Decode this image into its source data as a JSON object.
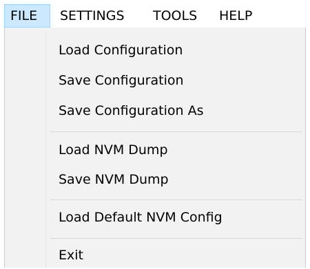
{
  "menubar": {
    "items": [
      {
        "label": "FILE",
        "active": true
      },
      {
        "label": "SETTINGS",
        "active": false
      },
      {
        "label": "TOOLS",
        "active": false
      },
      {
        "label": "HELP",
        "active": false
      }
    ]
  },
  "file_menu": {
    "items": [
      {
        "label": "Load Configuration"
      },
      {
        "label": "Save Configuration"
      },
      {
        "label": "Save Configuration As"
      },
      {
        "label": "Load NVM Dump"
      },
      {
        "label": "Save NVM Dump"
      },
      {
        "label": "Load Default NVM Config"
      },
      {
        "label": "Exit"
      }
    ]
  },
  "colors": {
    "active_menu_background": "#cce8ff",
    "active_menu_border": "#99d1ff",
    "dropdown_background": "#f2f2f2"
  }
}
